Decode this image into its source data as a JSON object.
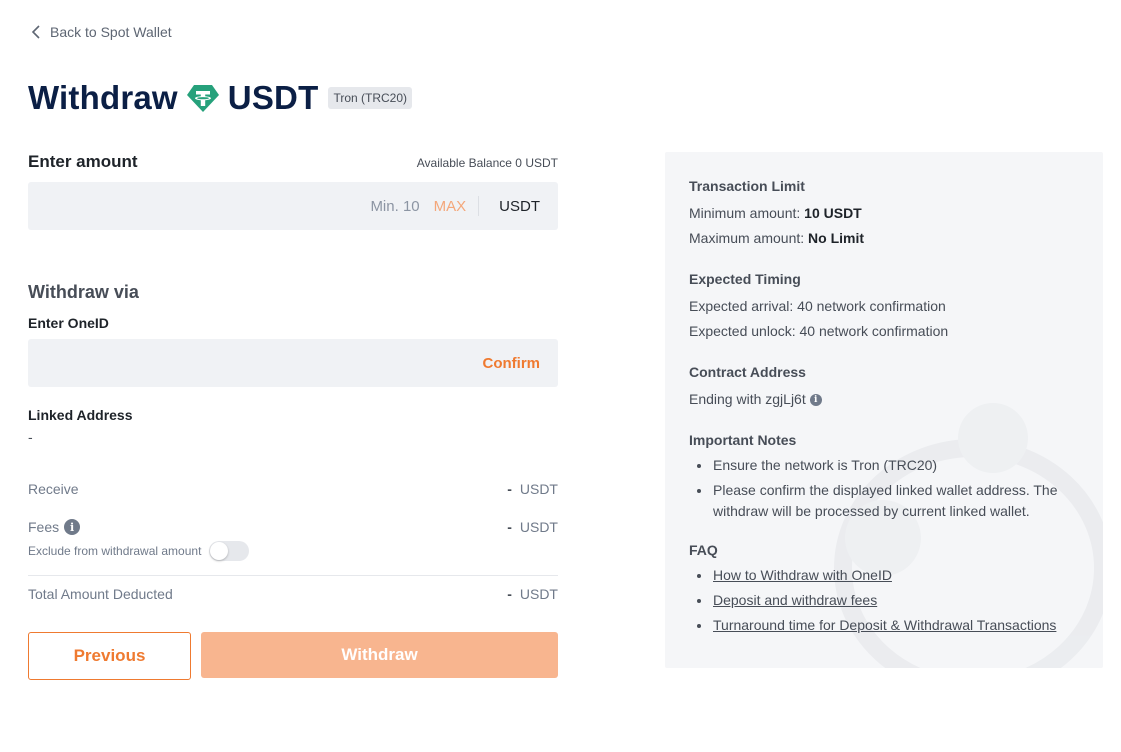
{
  "back": {
    "label": "Back to Spot Wallet"
  },
  "header": {
    "prefix": "Withdraw",
    "coin": "USDT",
    "network_badge": "Tron (TRC20)"
  },
  "amount": {
    "label": "Enter amount",
    "balance_label": "Available Balance",
    "balance_value": "0",
    "balance_unit": "USDT",
    "value": "",
    "min_label": "Min. 10",
    "max_label": "MAX",
    "unit": "USDT"
  },
  "via": {
    "title": "Withdraw via",
    "oneid_label": "Enter OneID",
    "oneid_value": "",
    "confirm_label": "Confirm",
    "linked_label": "Linked Address",
    "linked_value": "-"
  },
  "summary": {
    "receive_label": "Receive",
    "receive_value": "-",
    "receive_unit": "USDT",
    "fees_label": "Fees",
    "fees_value": "-",
    "fees_unit": "USDT",
    "exclude_label": "Exclude from withdrawal amount",
    "exclude_on": false,
    "total_label": "Total Amount Deducted",
    "total_value": "-",
    "total_unit": "USDT"
  },
  "buttons": {
    "previous": "Previous",
    "withdraw": "Withdraw"
  },
  "info": {
    "limit_title": "Transaction Limit",
    "min_label": "Minimum amount:",
    "min_value": "10 USDT",
    "max_label": "Maximum amount:",
    "max_value": "No Limit",
    "timing_title": "Expected Timing",
    "arrival": "Expected arrival: 40 network confirmation",
    "unlock": "Expected unlock: 40 network confirmation",
    "contract_title": "Contract Address",
    "contract_value": "Ending with zgjLj6t",
    "notes_title": "Important Notes",
    "notes": [
      "Ensure the network is Tron (TRC20)",
      "Please confirm the displayed linked wallet address. The withdraw will be processed by current linked wallet."
    ],
    "faq_title": "FAQ",
    "faq": [
      "How to Withdraw with OneID",
      "Deposit and withdraw fees",
      "Turnaround time for Deposit & Withdrawal Transactions"
    ]
  },
  "colors": {
    "accent": "#ef7a30",
    "accent_disabled": "#f8b58f",
    "tether": "#26a17b",
    "title": "#0b1f45"
  }
}
